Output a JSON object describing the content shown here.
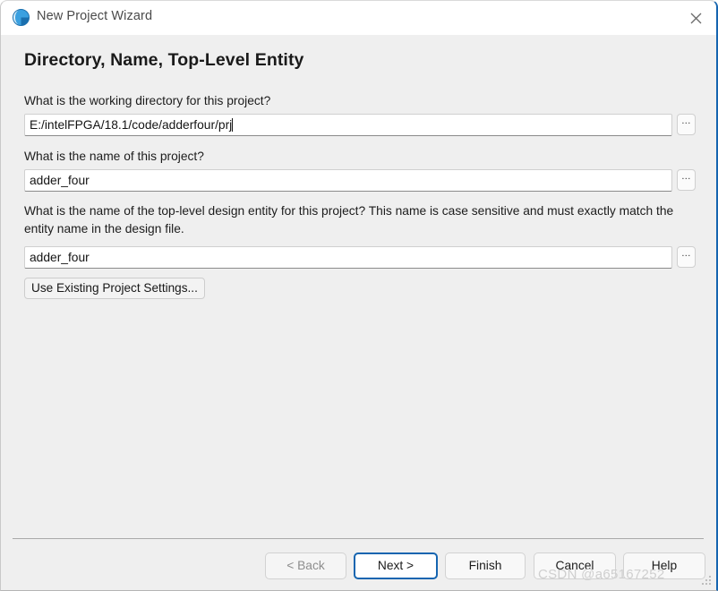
{
  "window": {
    "title": "New Project Wizard",
    "icon": "globe-icon",
    "close_label": "✕",
    "accent_color": "#1565b0",
    "body_bg": "#efefef",
    "titlebar_bg": "#ffffff"
  },
  "page": {
    "heading": "Directory, Name, Top-Level Entity"
  },
  "fields": [
    {
      "question": "What is the working directory for this project?",
      "value": "E:/intelFPGA/18.1/code/adderfour/prj",
      "browse_label": "...",
      "focused": true
    },
    {
      "question": "What is the name of this project?",
      "value": "adder_four",
      "browse_label": "...",
      "focused": false
    },
    {
      "question": "What is the name of the top-level design entity for this project? This name is case sensitive and must exactly match the entity name in the design file.",
      "value": "adder_four",
      "browse_label": "...",
      "focused": false
    }
  ],
  "actions": {
    "use_existing": "Use Existing Project Settings..."
  },
  "footer": {
    "buttons": [
      {
        "label": "< Back",
        "state": "disabled"
      },
      {
        "label": "Next >",
        "state": "focused"
      },
      {
        "label": "Finish",
        "state": "normal"
      },
      {
        "label": "Cancel",
        "state": "normal"
      },
      {
        "label": "Help",
        "state": "normal"
      }
    ]
  },
  "watermark": {
    "text": "CSDN @a65167252"
  }
}
